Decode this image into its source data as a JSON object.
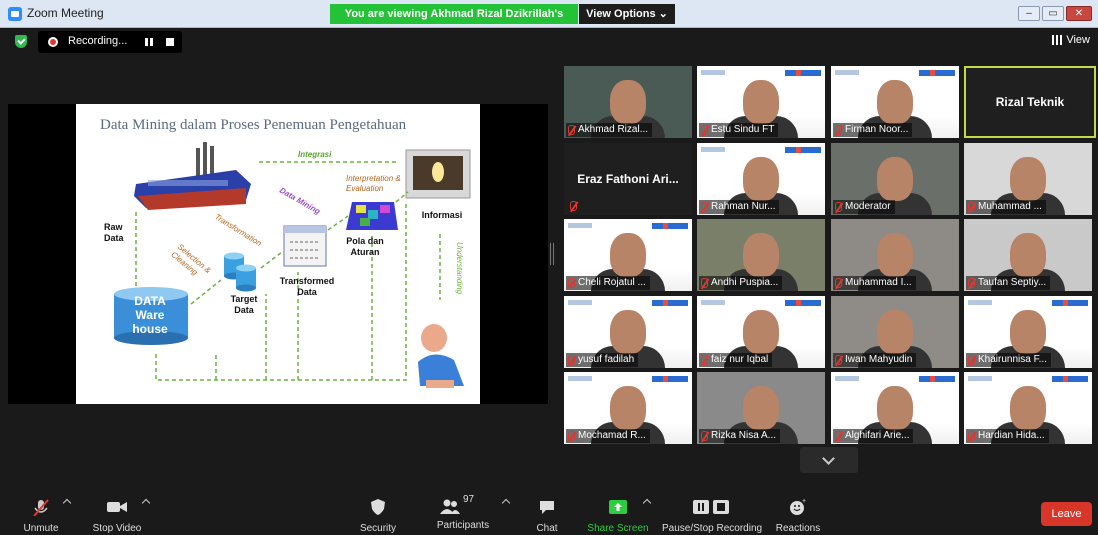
{
  "window": {
    "title": "Zoom Meeting"
  },
  "banner": {
    "text": "You are viewing Akhmad Rizal Dzikrillah's screen",
    "view_options": "View Options ⌄"
  },
  "topbar": {
    "recording_label": "Recording...",
    "view_label": "View"
  },
  "slide": {
    "title": "Data Mining dalam Proses Penemuan Pengetahuan",
    "raw_data": "Raw Data",
    "warehouse": "DATA Ware house",
    "target_data": "Target Data",
    "transformed_data": "Transformed Data",
    "pola": "Pola dan Aturan",
    "informasi": "Informasi",
    "integrasi": "Integrasi",
    "selection": "Selection & Cleaning",
    "transformation": "Transformation",
    "data_mining": "Data Mining",
    "interpretation": "Interpretation & Evaluation",
    "understanding": "Understanding"
  },
  "participants_grid": [
    {
      "name": "Akhmad Rizal...",
      "type": "video",
      "bg": "#4a5a55"
    },
    {
      "name": "Estu Sindu FT",
      "type": "slide"
    },
    {
      "name": "Firman Noor...",
      "type": "slide"
    },
    {
      "name": "Rizal Teknik",
      "type": "active"
    },
    {
      "name": "Eraz Fathoni Ari...",
      "type": "blank"
    },
    {
      "name": "Rahman Nur...",
      "type": "slide"
    },
    {
      "name": "Moderator",
      "type": "video",
      "bg": "#6b6f6a"
    },
    {
      "name": "Muhammad ...",
      "type": "video",
      "bg": "#d8d8d8"
    },
    {
      "name": "Cheli Rojatul ...",
      "type": "slide"
    },
    {
      "name": "Andhi Puspia...",
      "type": "video",
      "bg": "#7a7f6a"
    },
    {
      "name": "Muhammad I...",
      "type": "video",
      "bg": "#8e8a86"
    },
    {
      "name": "Taufan Septiy...",
      "type": "video",
      "bg": "#c9c9c9"
    },
    {
      "name": "yusuf fadilah",
      "type": "slide"
    },
    {
      "name": "faiz nur Iqbal",
      "type": "slide"
    },
    {
      "name": "Iwan Mahyudin",
      "type": "video",
      "bg": "#8f8c87"
    },
    {
      "name": "Khairunnisa F...",
      "type": "slide"
    },
    {
      "name": "Mochamad R...",
      "type": "slide"
    },
    {
      "name": "Rizka Nisa A...",
      "type": "video",
      "bg": "#8a8a8a"
    },
    {
      "name": "Alghifari Arie...",
      "type": "slide"
    },
    {
      "name": "Hardian Hida...",
      "type": "slide"
    }
  ],
  "toolbar": {
    "unmute": "Unmute",
    "stop_video": "Stop Video",
    "security": "Security",
    "participants": "Participants",
    "participants_count": "97",
    "chat": "Chat",
    "share_screen": "Share Screen",
    "pause_recording": "Pause/Stop Recording",
    "reactions": "Reactions",
    "leave": "Leave"
  }
}
